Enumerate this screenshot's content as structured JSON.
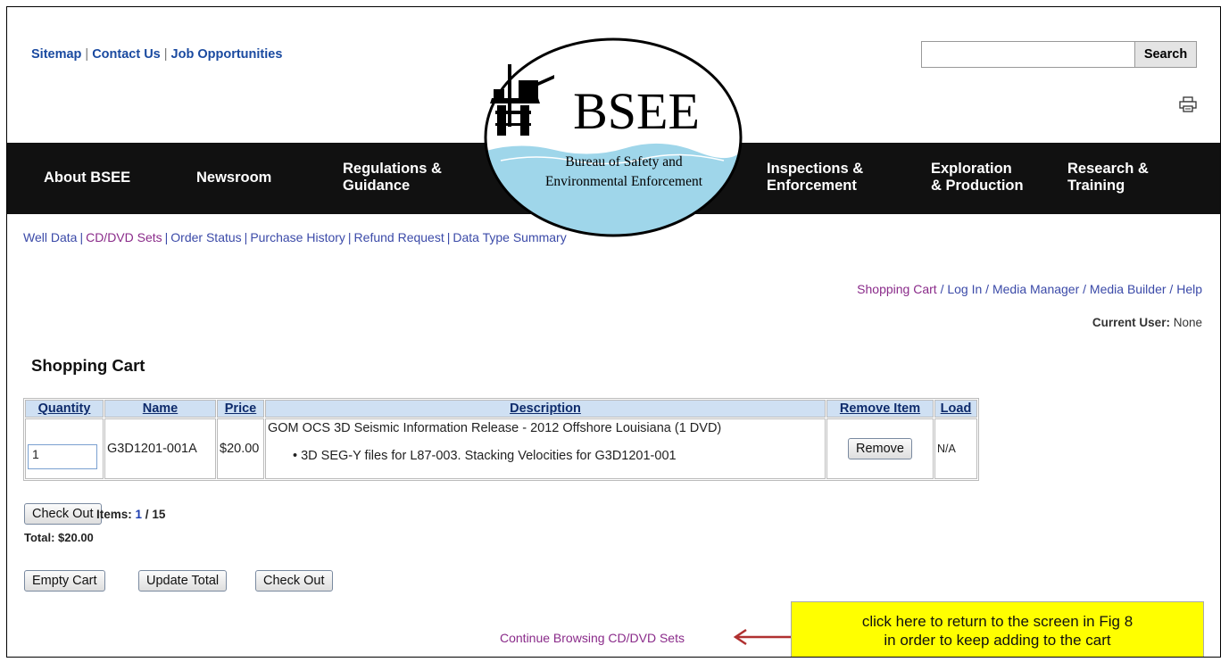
{
  "top_links": [
    "Sitemap",
    "Contact Us",
    "Job Opportunities"
  ],
  "search": {
    "button_label": "Search",
    "value": ""
  },
  "nav": [
    {
      "line1": "About BSEE",
      "line2": ""
    },
    {
      "line1": "Newsroom",
      "line2": ""
    },
    {
      "line1": "Regulations &",
      "line2": "Guidance"
    },
    {
      "line1": "Inspections &",
      "line2": "Enforcement"
    },
    {
      "line1": "Exploration",
      "line2": "& Production"
    },
    {
      "line1": "Research &",
      "line2": "Training"
    }
  ],
  "logo": {
    "text": "BSEE",
    "line1": "Bureau of Safety and",
    "line2": "Environmental Enforcement"
  },
  "subnav": [
    "Well Data",
    "CD/DVD Sets",
    "Order Status",
    "Purchase History",
    "Refund Request",
    "Data Type Summary"
  ],
  "user_nav": [
    "Shopping Cart",
    "Log In",
    "Media Manager",
    "Media Builder",
    "Help"
  ],
  "current_user": {
    "label": "Current User:",
    "value": "None"
  },
  "cart": {
    "title": "Shopping Cart",
    "headers": [
      "Quantity",
      "Name",
      "Price",
      "Description",
      "Remove Item",
      "Load"
    ],
    "row": {
      "quantity": "1",
      "name": "G3D1201-001A",
      "price": "$20.00",
      "desc_title": "GOM OCS 3D Seismic Information Release - 2012 Offshore Louisiana (1 DVD)",
      "desc_bullet": "3D SEG-Y files for L87-003. Stacking Velocities for G3D1201-001",
      "remove_label": "Remove",
      "load": "N/A"
    },
    "checkout_label": "Check Out",
    "items_label": "Items:",
    "items_count": "1",
    "items_max": "15",
    "total": "Total: $20.00",
    "buttons": [
      "Empty Cart",
      "Update Total",
      "Check Out"
    ]
  },
  "continue_link": "Continue Browsing CD/DVD Sets",
  "callout": {
    "line1": "click here to return to the screen in Fig 8",
    "line2": "in order to keep adding to the cart"
  },
  "colors": {
    "nav_bg": "#111111",
    "link": "#3b4aa8",
    "visited": "#8a2b8a",
    "callout_bg": "#ffff00",
    "header_bg": "#cfe0f3",
    "logo_water": "#9fd6ea"
  }
}
